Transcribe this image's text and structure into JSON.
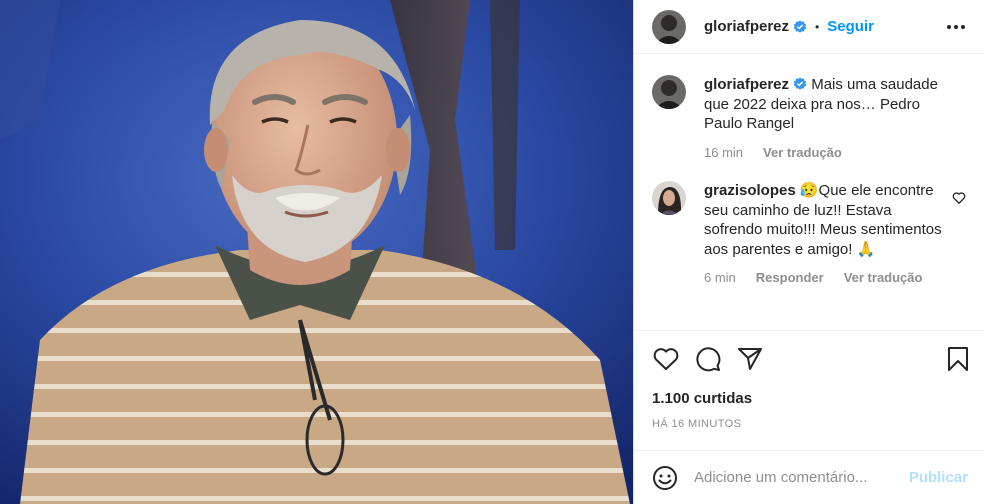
{
  "post": {
    "image_alt": "Pedro Paulo Rangel",
    "colors": {
      "accent": "#0095f6",
      "publish_disabled": "#b2dffc",
      "muted": "#8e8e8e"
    }
  },
  "header": {
    "username": "gloriafperez",
    "separator": "•",
    "follow_label": "Seguir",
    "more_icon": "more-horizontal-icon"
  },
  "caption": {
    "username": "gloriafperez",
    "text": "Mais uma saudade que 2022 deixa pra nos… Pedro Paulo Rangel",
    "time": "16 min",
    "translate": "Ver tradução"
  },
  "comments": [
    {
      "username": "grazisolopes",
      "text": "😥Que ele encontre seu caminho de luz!! Estava sofrendo muito!!! Meus sentimentos aos parentes e amigo! 🙏",
      "time": "6 min",
      "reply": "Responder",
      "translate": "Ver tradução"
    }
  ],
  "actions": {
    "like_icon": "heart-icon",
    "comment_icon": "comment-icon",
    "share_icon": "paper-plane-icon",
    "save_icon": "bookmark-icon"
  },
  "likes": "1.100 curtidas",
  "timestamp": "HÁ 16 MINUTOS",
  "add_comment": {
    "placeholder": "Adicione um comentário...",
    "publish_label": "Publicar"
  }
}
